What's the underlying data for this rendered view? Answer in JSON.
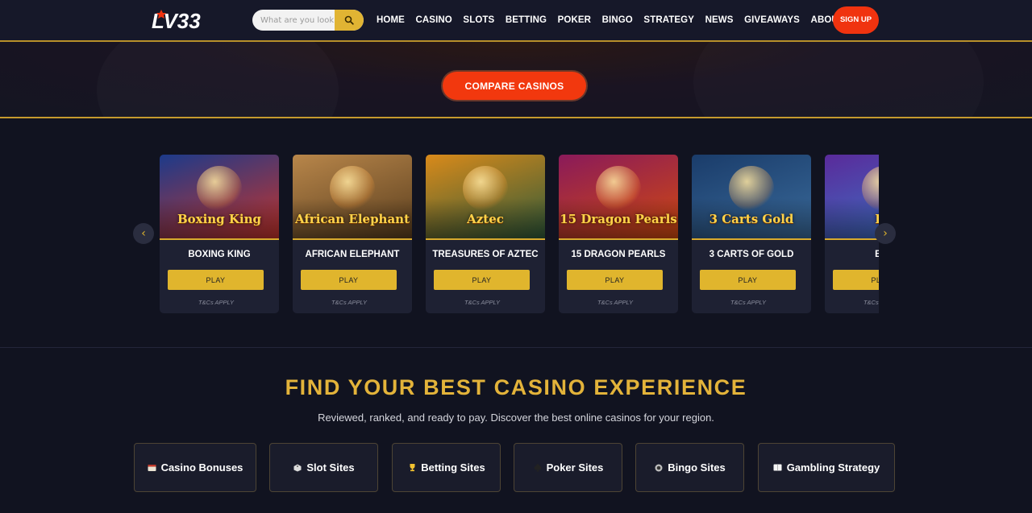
{
  "header": {
    "logo_text": "LV33",
    "search": {
      "placeholder": "What are you looking for?",
      "icon": "search-icon"
    },
    "nav": [
      "HOME",
      "CASINO",
      "SLOTS",
      "BETTING",
      "POKER",
      "BINGO",
      "STRATEGY",
      "NEWS",
      "GIVEAWAYS",
      "ABOUT US"
    ],
    "signup_label": "SIGN UP"
  },
  "hero": {
    "compare_label": "COMPARE CASINOS"
  },
  "carousel": {
    "prev_icon": "chevron-left-icon",
    "next_icon": "chevron-right-icon",
    "games": [
      {
        "name": "BOXING KING",
        "art_title": "Boxing King",
        "play": "PLAY",
        "tcs": "T&Cs APPLY",
        "colors": [
          "#1c3a8a",
          "#c7342b"
        ]
      },
      {
        "name": "AFRICAN ELEPHANT",
        "art_title": "African Elephant",
        "play": "PLAY",
        "tcs": "T&Cs APPLY",
        "colors": [
          "#b8864a",
          "#5a3e1e"
        ]
      },
      {
        "name": "TREASURES OF AZTEC",
        "art_title": "Aztec",
        "play": "PLAY",
        "tcs": "T&Cs APPLY",
        "colors": [
          "#d98a1a",
          "#2f5a3a"
        ]
      },
      {
        "name": "15 DRAGON PEARLS",
        "art_title": "15 Dragon Pearls",
        "play": "PLAY",
        "tcs": "T&Cs APPLY",
        "colors": [
          "#8a1a5a",
          "#d14a0f"
        ]
      },
      {
        "name": "3 CARTS OF GOLD",
        "art_title": "3 Carts Gold",
        "play": "PLAY",
        "tcs": "T&Cs APPLY",
        "colors": [
          "#1a3c6a",
          "#3a6a9a"
        ]
      },
      {
        "name": "BUZ",
        "art_title": "Bu",
        "play": "PLAY",
        "tcs": "T&Cs APPLY",
        "colors": [
          "#5a2a9a",
          "#3a78c8"
        ]
      }
    ]
  },
  "find": {
    "title": "FIND YOUR BEST CASINO EXPERIENCE",
    "subtitle": "Reviewed, ranked, and ready to pay. Discover the best online casinos for your region.",
    "categories": [
      {
        "label": "Casino Bonuses",
        "icon": "casino-chip-icon"
      },
      {
        "label": "Slot Sites",
        "icon": "dice-icon"
      },
      {
        "label": "Betting Sites",
        "icon": "trophy-icon"
      },
      {
        "label": "Poker Sites",
        "icon": "spade-icon"
      },
      {
        "label": "Bingo Sites",
        "icon": "bingo-ball-icon"
      },
      {
        "label": "Gambling Strategy",
        "icon": "book-icon"
      }
    ]
  },
  "colors": {
    "accent_gold": "#e3b33a",
    "cta_orange": "#f2380e",
    "bg": "#111320"
  }
}
